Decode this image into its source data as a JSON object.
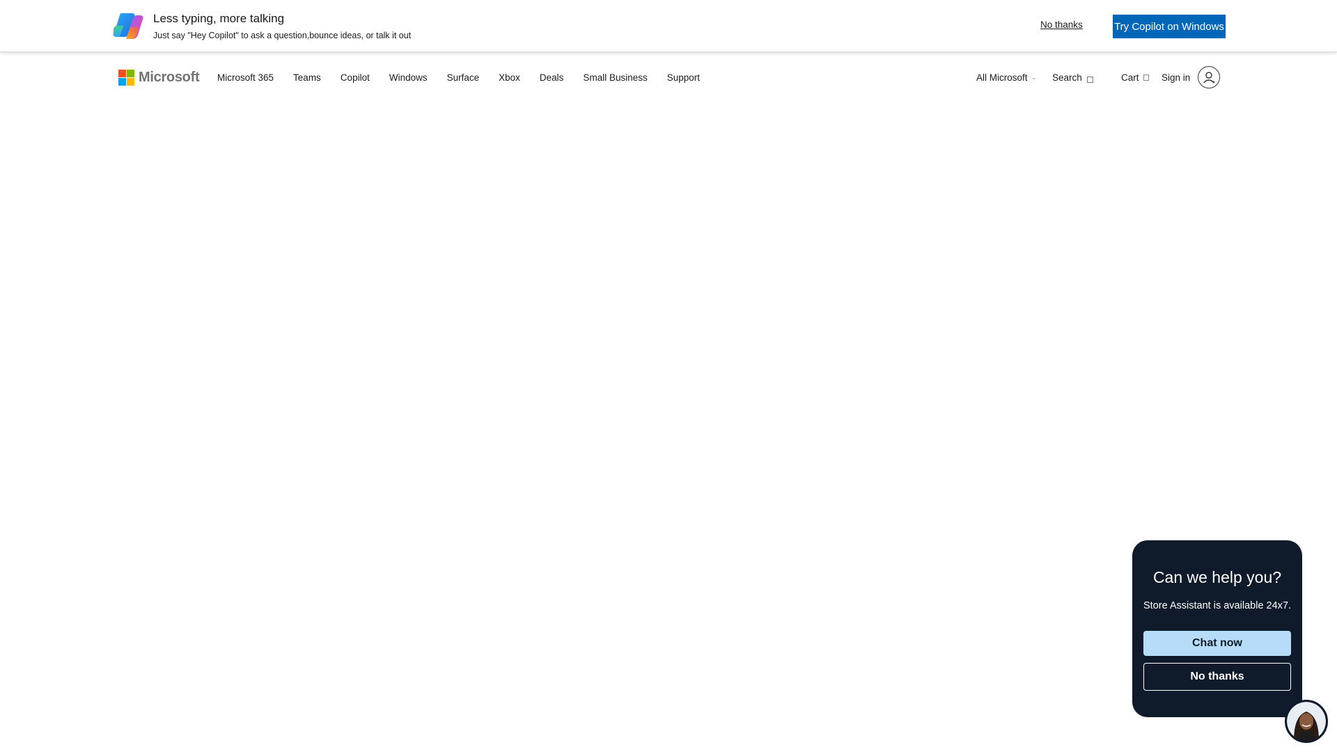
{
  "banner": {
    "headline": "Less typing, more talking",
    "subline": "Just say \"Hey Copilot\" to ask a question,bounce ideas, or talk it out",
    "no_thanks": "No thanks",
    "cta": "Try Copilot on Windows",
    "cta_color": "#0067b8"
  },
  "header": {
    "brand": "Microsoft",
    "logo_colors": [
      "#f25022",
      "#7fba00",
      "#00a4ef",
      "#ffb900"
    ],
    "nav": [
      "Microsoft 365",
      "Teams",
      "Copilot",
      "Windows",
      "Surface",
      "Xbox",
      "Deals",
      "Small Business",
      "Support"
    ],
    "all_microsoft": "All Microsoft",
    "search": "Search",
    "cart": "Cart",
    "sign_in": "Sign in",
    "icons": {
      "all_microsoft": "chevron-down-icon",
      "search": "search-icon",
      "cart": "cart-icon",
      "account": "user-account-icon"
    }
  },
  "chat": {
    "title": "Can we help you?",
    "subtitle": "Store Assistant is available 24x7.",
    "chat_now": "Chat now",
    "no_thanks": "No thanks",
    "card_color": "#0f1a2a",
    "chat_button_color": "#b7dcf7"
  }
}
